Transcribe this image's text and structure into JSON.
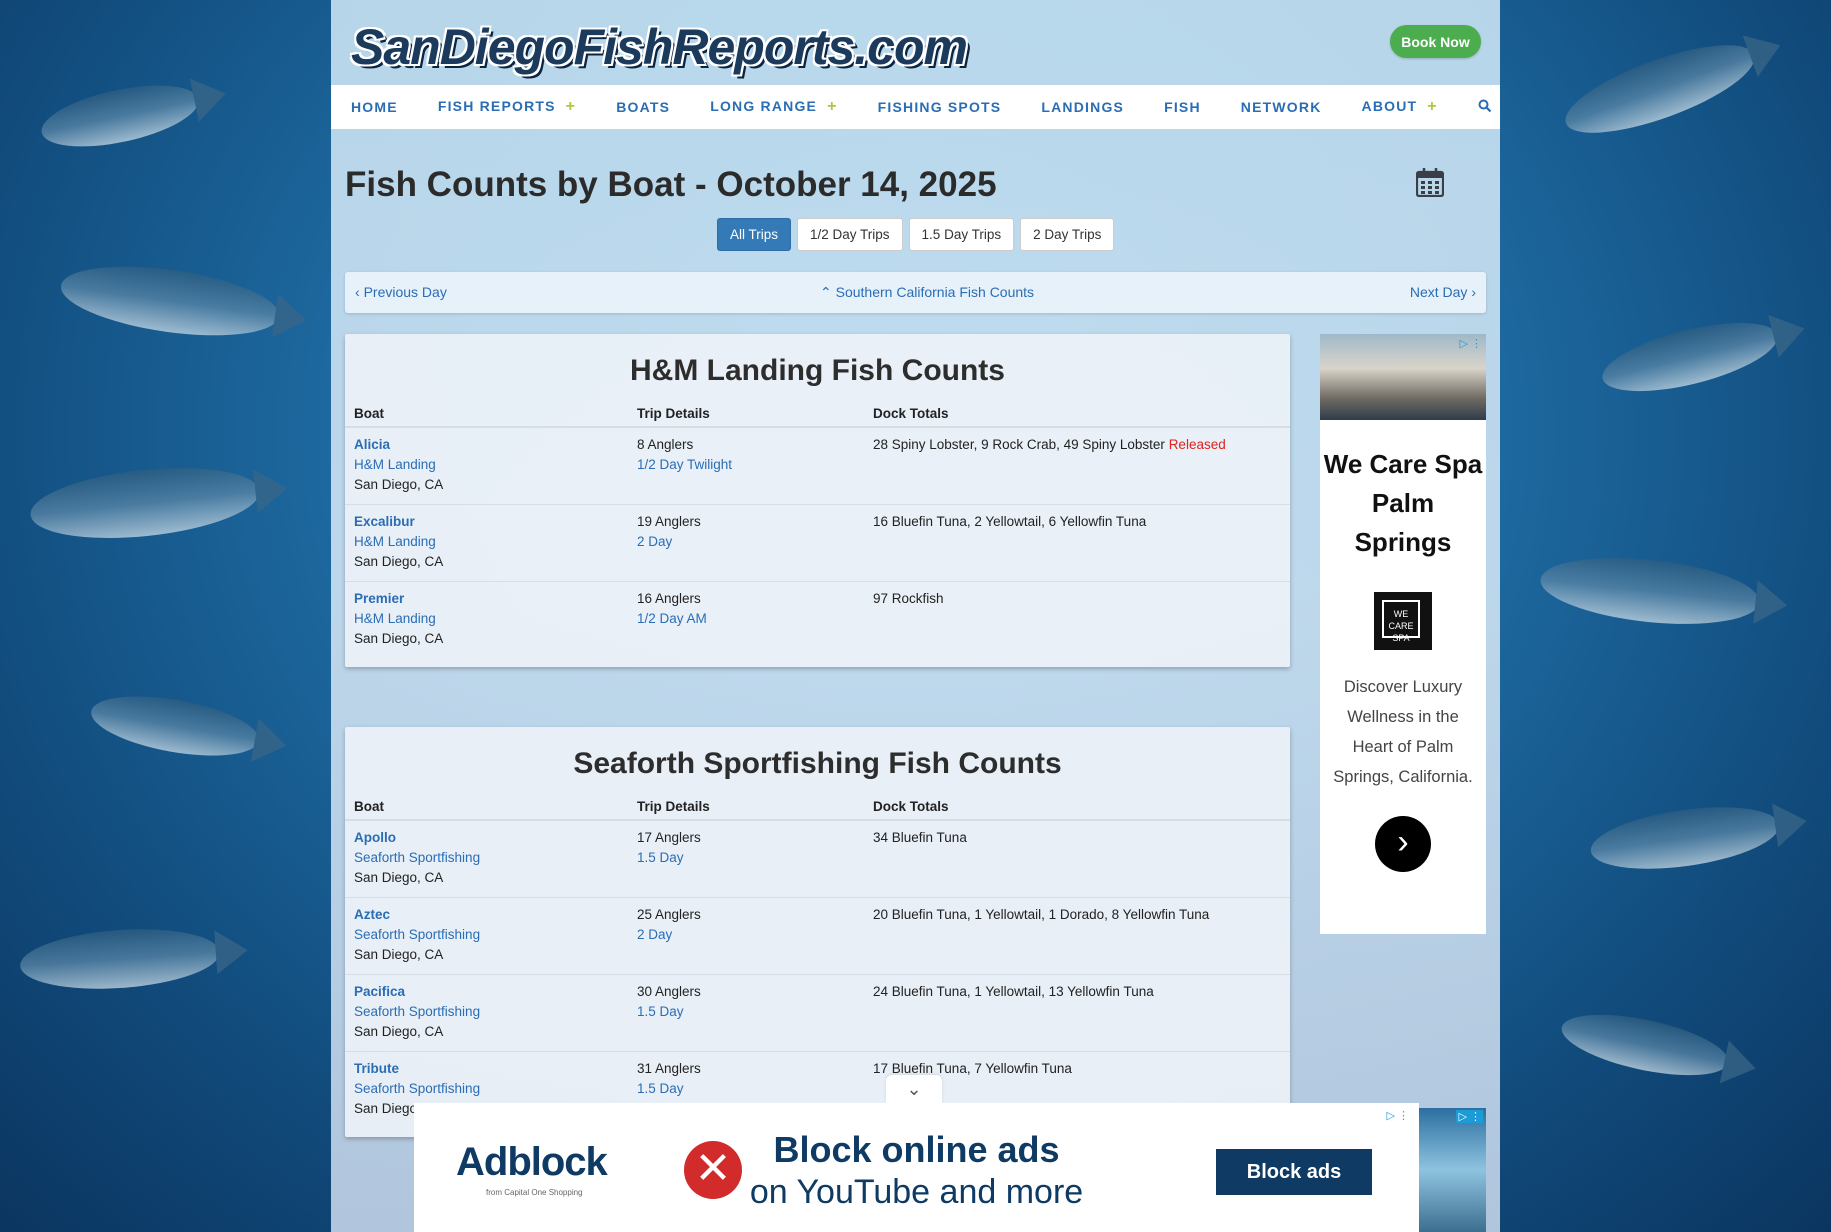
{
  "site": {
    "logo": "SanDiegoFishReports.com",
    "book_label": "Book Now"
  },
  "nav": [
    {
      "label": "HOME",
      "plus": false
    },
    {
      "label": "FISH REPORTS",
      "plus": true
    },
    {
      "label": "BOATS",
      "plus": false
    },
    {
      "label": "LONG RANGE",
      "plus": true
    },
    {
      "label": "FISHING SPOTS",
      "plus": false
    },
    {
      "label": "LANDINGS",
      "plus": false
    },
    {
      "label": "FISH",
      "plus": false
    },
    {
      "label": "NETWORK",
      "plus": false
    },
    {
      "label": "ABOUT",
      "plus": true
    }
  ],
  "page": {
    "title": "Fish Counts by Boat - October 14, 2025"
  },
  "filters": [
    "All Trips",
    "1/2 Day Trips",
    "1.5 Day Trips",
    "2 Day Trips"
  ],
  "daybar": {
    "prev": "Previous Day",
    "center": "Southern California Fish Counts",
    "next": "Next Day"
  },
  "columns": {
    "boat": "Boat",
    "trip": "Trip Details",
    "dock": "Dock Totals"
  },
  "landings": [
    {
      "title": "H&M Landing Fish Counts",
      "rows": [
        {
          "boat": "Alicia",
          "landing": "H&M Landing",
          "city": "San Diego, CA",
          "anglers": "8 Anglers",
          "trip": "1/2 Day Twilight",
          "dock": "28 Spiny Lobster, 9 Rock Crab, 49 Spiny Lobster",
          "released": "Released"
        },
        {
          "boat": "Excalibur",
          "landing": "H&M Landing",
          "city": "San Diego, CA",
          "anglers": "19 Anglers",
          "trip": "2 Day",
          "dock": "16 Bluefin Tuna, 2 Yellowtail, 6 Yellowfin Tuna",
          "released": ""
        },
        {
          "boat": "Premier",
          "landing": "H&M Landing",
          "city": "San Diego, CA",
          "anglers": "16 Anglers",
          "trip": "1/2 Day AM",
          "dock": "97 Rockfish",
          "released": ""
        }
      ]
    },
    {
      "title": "Seaforth Sportfishing Fish Counts",
      "rows": [
        {
          "boat": "Apollo",
          "landing": "Seaforth Sportfishing",
          "city": "San Diego, CA",
          "anglers": "17 Anglers",
          "trip": "1.5 Day",
          "dock": "34 Bluefin Tuna",
          "released": ""
        },
        {
          "boat": "Aztec",
          "landing": "Seaforth Sportfishing",
          "city": "San Diego, CA",
          "anglers": "25 Anglers",
          "trip": "2 Day",
          "dock": "20 Bluefin Tuna, 1 Yellowtail, 1 Dorado, 8 Yellowfin Tuna",
          "released": ""
        },
        {
          "boat": "Pacifica",
          "landing": "Seaforth Sportfishing",
          "city": "San Diego, CA",
          "anglers": "30 Anglers",
          "trip": "1.5 Day",
          "dock": "24 Bluefin Tuna, 1 Yellowtail, 13 Yellowfin Tuna",
          "released": ""
        },
        {
          "boat": "Tribute",
          "landing": "Seaforth Sportfishing",
          "city": "San Diego, CA",
          "anglers": "31 Anglers",
          "trip": "1.5 Day",
          "dock": "17 Bluefin Tuna, 7 Yellowfin Tuna",
          "released": ""
        }
      ]
    }
  ],
  "side_ad": {
    "headline": "We Care Spa Palm Springs",
    "logo_text": "WE CARE SPA",
    "body": "Discover Luxury Wellness in the Heart of Palm Springs, California."
  },
  "bottom_ad": {
    "brand": "Adblock",
    "sub": "from Capital One Shopping",
    "line1": "Block online ads",
    "line2": "on YouTube and more",
    "cta": "Block ads"
  },
  "icons": [
    "search-icon",
    "calendar-icon",
    "chevron-left-icon",
    "chevron-up-icon",
    "chevron-right-icon",
    "chevron-down-icon",
    "close-icon",
    "adchoices-icon"
  ],
  "colors": {
    "link": "#2a6db5",
    "book": "#4cad4f",
    "active_filter": "#337ab7",
    "released": "#e0211d",
    "adblock_navy": "#0e3a63"
  }
}
